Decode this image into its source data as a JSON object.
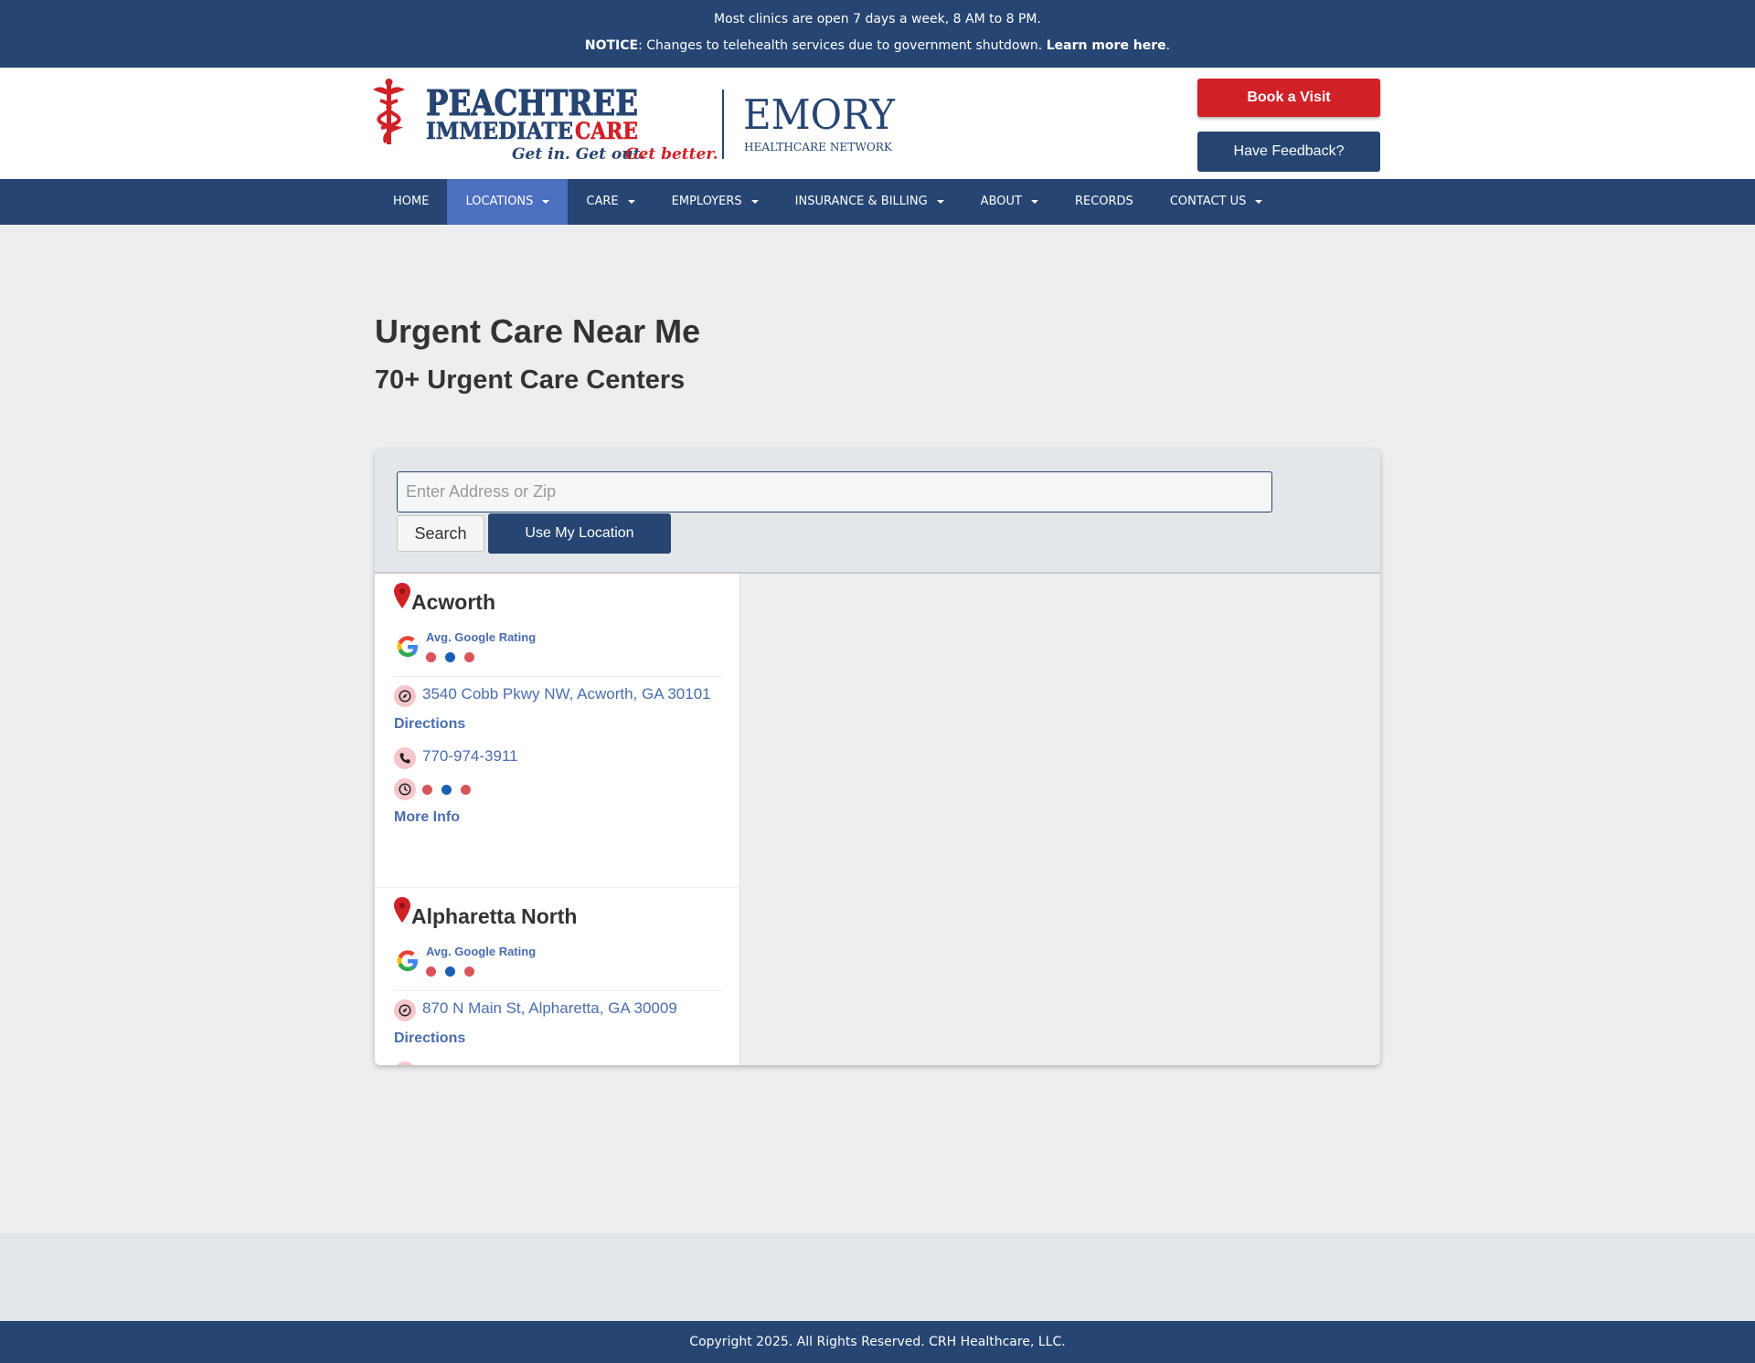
{
  "notice_bar": {
    "line1": "Most clinics are open 7 days a week, 8 AM to 8 PM.",
    "notice_label": "NOTICE",
    "notice_text": ": Changes to telehealth services due to government shutdown. ",
    "learn_more": "Learn more here",
    "period": "."
  },
  "header": {
    "logo": {
      "brand_line1": "PEACHTREE",
      "brand_line2a": "IMMEDIATE",
      "brand_line2b": "CARE",
      "tagline_a": "Get in. Get out.",
      "tagline_b": "Get better.",
      "partner_name": "EMORY",
      "partner_sub": "HEALTHCARE NETWORK"
    },
    "book_button": "Book a Visit",
    "feedback_button": "Have Feedback?"
  },
  "nav": {
    "items": [
      {
        "label": "HOME",
        "dropdown": false,
        "active": false
      },
      {
        "label": "LOCATIONS",
        "dropdown": true,
        "active": true
      },
      {
        "label": "CARE",
        "dropdown": true,
        "active": false
      },
      {
        "label": "EMPLOYERS",
        "dropdown": true,
        "active": false
      },
      {
        "label": "INSURANCE & BILLING",
        "dropdown": true,
        "active": false
      },
      {
        "label": "ABOUT",
        "dropdown": true,
        "active": false
      },
      {
        "label": "RECORDS",
        "dropdown": false,
        "active": false
      },
      {
        "label": "CONTACT US",
        "dropdown": true,
        "active": false
      }
    ]
  },
  "page": {
    "title": "Urgent Care Near Me",
    "subtitle": "70+ Urgent Care Centers"
  },
  "locator": {
    "search_placeholder": "Enter Address or Zip",
    "search_value": "",
    "search_button": "Search",
    "location_button": "Use My Location",
    "locations": [
      {
        "name": "Acworth",
        "rating_label": "Avg. Google Rating",
        "address": "3540 Cobb Pkwy NW, Acworth, GA 30101",
        "directions": "Directions",
        "phone": "770-974-3911",
        "more_info": "More Info"
      },
      {
        "name": "Alpharetta North",
        "rating_label": "Avg. Google Rating",
        "address": "870 N Main St, Alpharetta, GA 30009",
        "directions": "Directions"
      }
    ]
  },
  "footer": {
    "copyright": "Copyright 2025. All Rights Reserved. CRH Healthcare, LLC."
  },
  "colors": {
    "navy": "#264572",
    "nav_active": "#4d6fbf",
    "brand_red": "#d02127",
    "link_blue": "#4a6db0",
    "loading_dot_red": "#d9535b",
    "loading_dot_blue": "#1a5fb4"
  },
  "icons": {
    "pin": "map-pin-icon",
    "google": "google-g-icon",
    "address": "compass-icon",
    "phone": "phone-icon",
    "hours": "clock-icon"
  }
}
